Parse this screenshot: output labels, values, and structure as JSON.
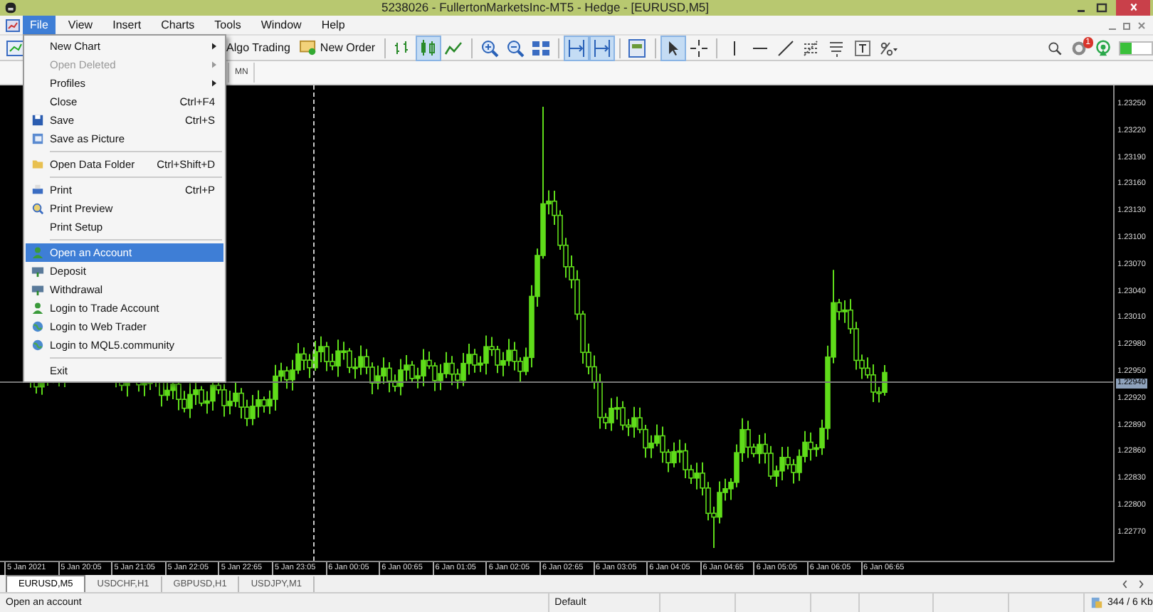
{
  "window": {
    "title": "5238026 - FullertonMarketsInc-MT5 - Hedge - [EURUSD,M5]"
  },
  "menu_bar": [
    {
      "label": "File",
      "selected": true
    },
    {
      "label": "View",
      "selected": false
    },
    {
      "label": "Insert",
      "selected": false
    },
    {
      "label": "Charts",
      "selected": false
    },
    {
      "label": "Tools",
      "selected": false
    },
    {
      "label": "Window",
      "selected": false
    },
    {
      "label": "Help",
      "selected": false
    }
  ],
  "file_menu": [
    {
      "kind": "item",
      "label": "New Chart",
      "submenu": true,
      "disabled": false,
      "selected": false
    },
    {
      "kind": "item",
      "label": "Open Deleted",
      "submenu": true,
      "disabled": true,
      "selected": false
    },
    {
      "kind": "item",
      "label": "Profiles",
      "submenu": true,
      "disabled": false,
      "selected": false
    },
    {
      "kind": "item",
      "label": "Close",
      "shortcut": "Ctrl+F4",
      "disabled": false,
      "selected": false
    },
    {
      "kind": "item",
      "label": "Save",
      "shortcut": "Ctrl+S",
      "disabled": false,
      "selected": false
    },
    {
      "kind": "item",
      "label": "Save as Picture",
      "disabled": false,
      "selected": false
    },
    {
      "kind": "separator"
    },
    {
      "kind": "item",
      "label": "Open Data Folder",
      "shortcut": "Ctrl+Shift+D",
      "disabled": false,
      "selected": false
    },
    {
      "kind": "separator"
    },
    {
      "kind": "item",
      "label": "Print",
      "shortcut": "Ctrl+P",
      "disabled": false,
      "selected": false
    },
    {
      "kind": "item",
      "label": "Print Preview",
      "disabled": false,
      "selected": false
    },
    {
      "kind": "item",
      "label": "Print Setup",
      "disabled": false,
      "selected": false
    },
    {
      "kind": "separator"
    },
    {
      "kind": "item",
      "label": "Open an Account",
      "disabled": false,
      "selected": true
    },
    {
      "kind": "item",
      "label": "Deposit",
      "disabled": false,
      "selected": false
    },
    {
      "kind": "item",
      "label": "Withdrawal",
      "disabled": false,
      "selected": false
    },
    {
      "kind": "item",
      "label": "Login to Trade Account",
      "disabled": false,
      "selected": false
    },
    {
      "kind": "item",
      "label": "Login to Web Trader",
      "disabled": false,
      "selected": false
    },
    {
      "kind": "item",
      "label": "Login to MQL5.community",
      "disabled": false,
      "selected": false
    },
    {
      "kind": "separator"
    },
    {
      "kind": "item",
      "label": "Exit",
      "disabled": false,
      "selected": false
    }
  ],
  "toolbar": {
    "buttons": [
      {
        "label": "Algo Trading"
      },
      {
        "label": "New Order"
      }
    ],
    "tools": [
      {
        "selected": false
      },
      {
        "selected": true
      },
      {
        "selected": false
      },
      {
        "selected": false
      },
      {
        "selected": false
      },
      {
        "selected": false
      },
      {
        "selected": true
      },
      {
        "selected": true
      },
      {
        "selected": false
      },
      {
        "selected": true
      },
      {
        "selected": false
      },
      {
        "selected": false
      },
      {
        "selected": false
      },
      {
        "selected": false
      },
      {
        "selected": false
      },
      {
        "selected": false
      },
      {
        "selected": false
      },
      {
        "selected": false
      }
    ],
    "notification_badge": "1"
  },
  "timeframes": [
    "MN"
  ],
  "chart": {
    "price_labels": [
      "1.23250",
      "1.23220",
      "1.23190",
      "1.23160",
      "1.23130",
      "1.23100",
      "1.23070",
      "1.23040",
      "1.23010",
      "1.22980",
      "1.22950",
      "1.22920",
      "1.22890",
      "1.22860",
      "1.22830",
      "1.22800",
      "1.22770"
    ],
    "current_price": "1.22940",
    "time_labels": [
      "5 Jan 2021",
      "5 Jan 20:05",
      "5 Jan 21:05",
      "5 Jan 22:05",
      "5 Jan 22:65",
      "5 Jan 23:05",
      "6 Jan 00:05",
      "6 Jan 00:65",
      "6 Jan 01:05",
      "6 Jan 02:05",
      "6 Jan 02:65",
      "6 Jan 03:05",
      "6 Jan 04:05",
      "6 Jan 04:65",
      "6 Jan 05:05",
      "6 Jan 06:05",
      "6 Jan 06:65"
    ]
  },
  "chart_tabs": [
    {
      "label": "EURUSD,M5",
      "selected": true
    },
    {
      "label": "USDCHF,H1",
      "selected": false
    },
    {
      "label": "GBPUSD,H1",
      "selected": false
    },
    {
      "label": "USDJPY,M1",
      "selected": false
    }
  ],
  "status_bar": {
    "message": "Open an account",
    "profile": "Default",
    "traffic": "344 / 6 Kb"
  }
}
